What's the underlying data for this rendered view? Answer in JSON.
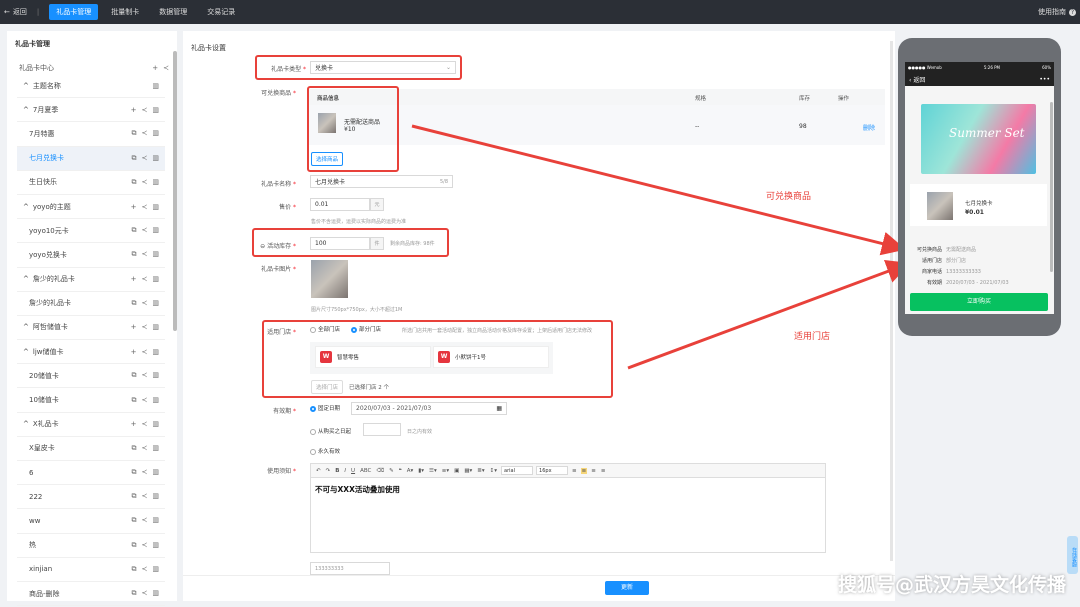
{
  "topbar": {
    "back": "返回",
    "tabs": [
      "礼品卡管理",
      "批量制卡",
      "数据管理",
      "交易记录"
    ],
    "active_tab": 0,
    "help": "使用指南"
  },
  "sidebar": {
    "title": "礼品卡管理",
    "root": "礼品卡中心",
    "items": [
      {
        "label": "主题名称",
        "level": "g",
        "expand": true,
        "icons": [
          "trash"
        ]
      },
      {
        "label": "7月夏季",
        "level": "g",
        "expand": true,
        "icons": [
          "plus",
          "share",
          "trash"
        ]
      },
      {
        "label": "7月特惠",
        "level": "c",
        "icons": [
          "copy",
          "share",
          "trash"
        ]
      },
      {
        "label": "七月兑换卡",
        "level": "c",
        "selected": true,
        "icons": [
          "copy",
          "share",
          "trash"
        ]
      },
      {
        "label": "生日快乐",
        "level": "c",
        "icons": [
          "copy",
          "share",
          "trash"
        ]
      },
      {
        "label": "yoyo的主题",
        "level": "g",
        "expand": true,
        "icons": [
          "plus",
          "share",
          "trash"
        ]
      },
      {
        "label": "yoyo10元卡",
        "level": "c",
        "icons": [
          "copy",
          "share",
          "trash"
        ]
      },
      {
        "label": "yoyo兑换卡",
        "level": "c",
        "icons": [
          "copy",
          "share",
          "trash"
        ]
      },
      {
        "label": "詹少的礼品卡",
        "level": "g",
        "expand": true,
        "icons": [
          "plus",
          "share",
          "trash"
        ]
      },
      {
        "label": "詹少的礼品卡",
        "level": "c",
        "icons": [
          "copy",
          "share",
          "trash"
        ]
      },
      {
        "label": "阿哲储值卡",
        "level": "g",
        "expand": true,
        "icons": [
          "plus",
          "share",
          "trash"
        ]
      },
      {
        "label": "ljw储值卡",
        "level": "g",
        "expand": true,
        "icons": [
          "plus",
          "share",
          "trash"
        ]
      },
      {
        "label": "20储值卡",
        "level": "c",
        "icons": [
          "copy",
          "share",
          "trash"
        ]
      },
      {
        "label": "10储值卡",
        "level": "c",
        "icons": [
          "copy",
          "share",
          "trash"
        ]
      },
      {
        "label": "X礼品卡",
        "level": "g",
        "expand": true,
        "icons": [
          "plus",
          "share",
          "trash"
        ]
      },
      {
        "label": "X皇皮卡",
        "level": "c",
        "icons": [
          "copy",
          "share",
          "trash"
        ]
      },
      {
        "label": "6",
        "level": "c",
        "icons": [
          "copy",
          "share",
          "trash"
        ]
      },
      {
        "label": "222",
        "level": "c",
        "icons": [
          "copy",
          "share",
          "trash"
        ]
      },
      {
        "label": "ww",
        "level": "c",
        "icons": [
          "copy",
          "share",
          "trash"
        ]
      },
      {
        "label": "热",
        "level": "c",
        "icons": [
          "copy",
          "share",
          "trash"
        ]
      },
      {
        "label": "xinjian",
        "level": "c",
        "icons": [
          "copy",
          "share",
          "trash"
        ]
      },
      {
        "label": "商品-删除",
        "level": "c",
        "icons": [
          "copy",
          "share",
          "trash"
        ]
      }
    ]
  },
  "form": {
    "title": "礼品卡设置",
    "card_type_label": "礼品卡类型",
    "card_type_value": "兑换卡",
    "goods_label": "可兑换商品",
    "goods_cols": [
      "商品信息",
      "规格",
      "库存",
      "操作"
    ],
    "goods_name": "无需配送商品",
    "goods_price": "¥10",
    "goods_spec": "--",
    "goods_stock": "98",
    "goods_action": "删除",
    "select_goods_btn": "选择商品",
    "name_label": "礼品卡名称",
    "name_value": "七月兑换卡",
    "name_count": "5/8",
    "price_label": "售价",
    "price_value": "0.01",
    "price_unit": "元",
    "price_hint": "售价不含运费，运费以实际商品的运费为准",
    "stock_label": "活动库存",
    "stock_value": "100",
    "stock_unit": "件",
    "stock_hint": "剩余商品库存: 98件",
    "image_label": "礼品卡图片",
    "image_hint": "图片尺寸750px*750px，大小不超过1M",
    "store_label": "适用门店",
    "store_all": "全部门店",
    "store_part": "部分门店",
    "store_hint": "所选门店共用一套活动配置，独立商品活动价格及库存设置；上架后适用门店无法修改",
    "stores": [
      "智慧零售",
      "小默饼干1号"
    ],
    "select_store_btn": "选择门店",
    "selected_count": "已选择门店 2 个",
    "valid_label": "有效期",
    "valid_fixed": "固定日期",
    "valid_range": "2020/07/03 - 2021/07/03",
    "valid_from": "从购买之日起",
    "valid_days_suffix": "日之内有效",
    "valid_forever": "永久有效",
    "notice_label": "使用须知",
    "notice_text": "不可与XXX活动叠加使用",
    "notice_below": "133333333",
    "editor_font": "arial",
    "editor_size": "16px",
    "save_btn": "更新"
  },
  "phone": {
    "carrier": "●●●●● Wemob",
    "time": "5:26 PM",
    "battery": "60%",
    "back": "返回",
    "banner_title": "Summer Set",
    "card_name": "七月兑换卡",
    "card_price": "¥0.01",
    "info": [
      {
        "k": "可兑换商品",
        "v": "无需配送商品"
      },
      {
        "k": "适用门店",
        "v": "部分门店"
      },
      {
        "k": "商家电话",
        "v": "13333333333"
      },
      {
        "k": "有效期",
        "v": "2020/07/03 - 2021/07/03"
      }
    ],
    "buy_btn": "立即购买"
  },
  "annotations": {
    "goods": "可兑换商品",
    "stores": "适用门店"
  },
  "watermark": "搜狐号@武汉方昊文化传播",
  "float_tab": "在线客服"
}
